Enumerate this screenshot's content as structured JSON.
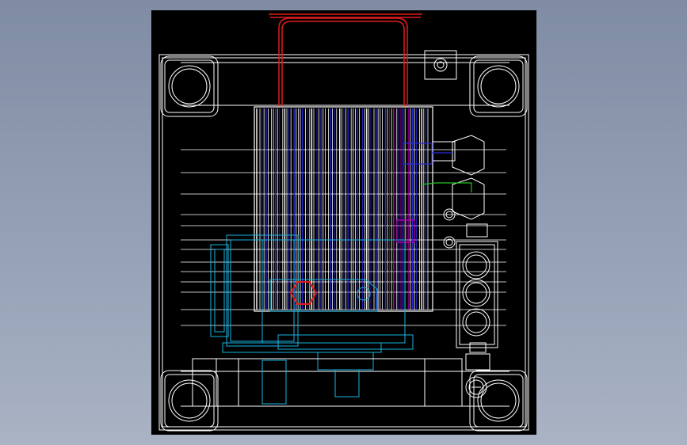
{
  "viewport": {
    "background_top": "#7f8ca3",
    "background_bottom": "#a9b3c4"
  },
  "drawing": {
    "background": "#000000",
    "colors": {
      "frame": "#ffffff",
      "lifting_handle": "#e11a1a",
      "motor_outline": "#ffffff",
      "motor_stripes_blue": "#2a2ad8",
      "motor_stripes_magenta": "#c000c0",
      "pump_cyan": "#19b5e0",
      "pipe_green": "#22c022",
      "seal_red": "#e11a1a"
    },
    "components": [
      "lifting-handle",
      "motor-housing",
      "mounting-bolt-pads",
      "gear-pump",
      "valve-block",
      "pipe-fittings",
      "base-tank",
      "filler-cap"
    ]
  }
}
